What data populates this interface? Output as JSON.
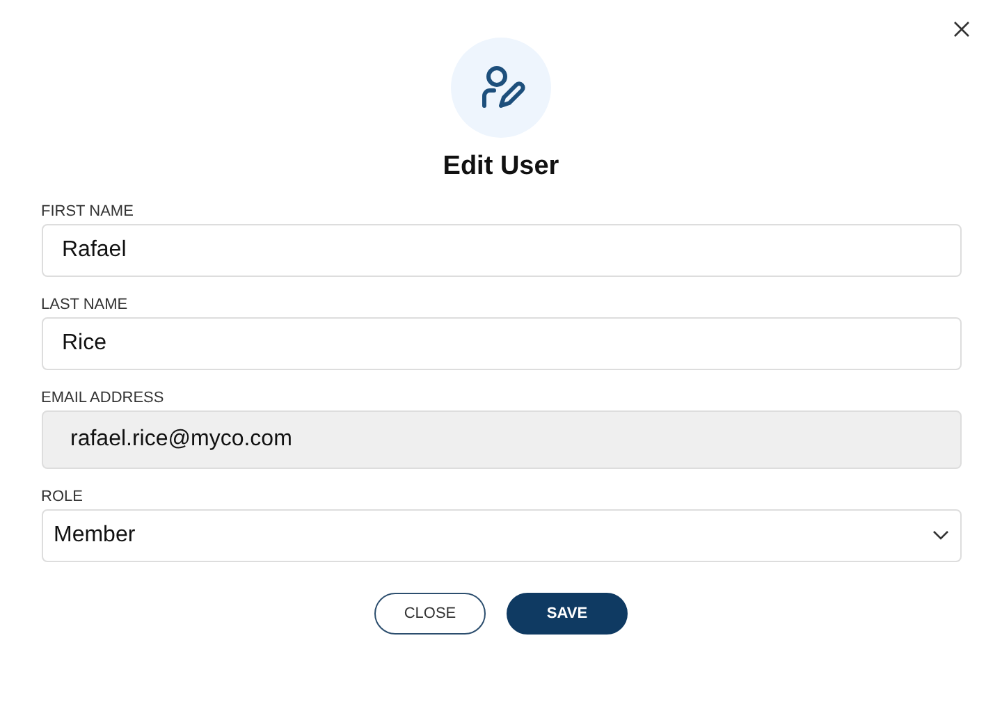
{
  "dialog": {
    "title": "Edit User"
  },
  "fields": [
    {
      "label": "FIRST NAME",
      "value": "Rafael",
      "kind": "text",
      "disabled": false
    },
    {
      "label": "LAST NAME",
      "value": "Rice",
      "kind": "text",
      "disabled": false
    },
    {
      "label": "EMAIL ADDRESS",
      "value": "rafael.rice@myco.com",
      "kind": "text",
      "disabled": true
    },
    {
      "label": "ROLE",
      "value": "Member",
      "kind": "select",
      "disabled": false
    }
  ],
  "buttons": [
    {
      "label": "CLOSE",
      "kind": "secondary"
    },
    {
      "label": "SAVE",
      "kind": "primary"
    }
  ]
}
